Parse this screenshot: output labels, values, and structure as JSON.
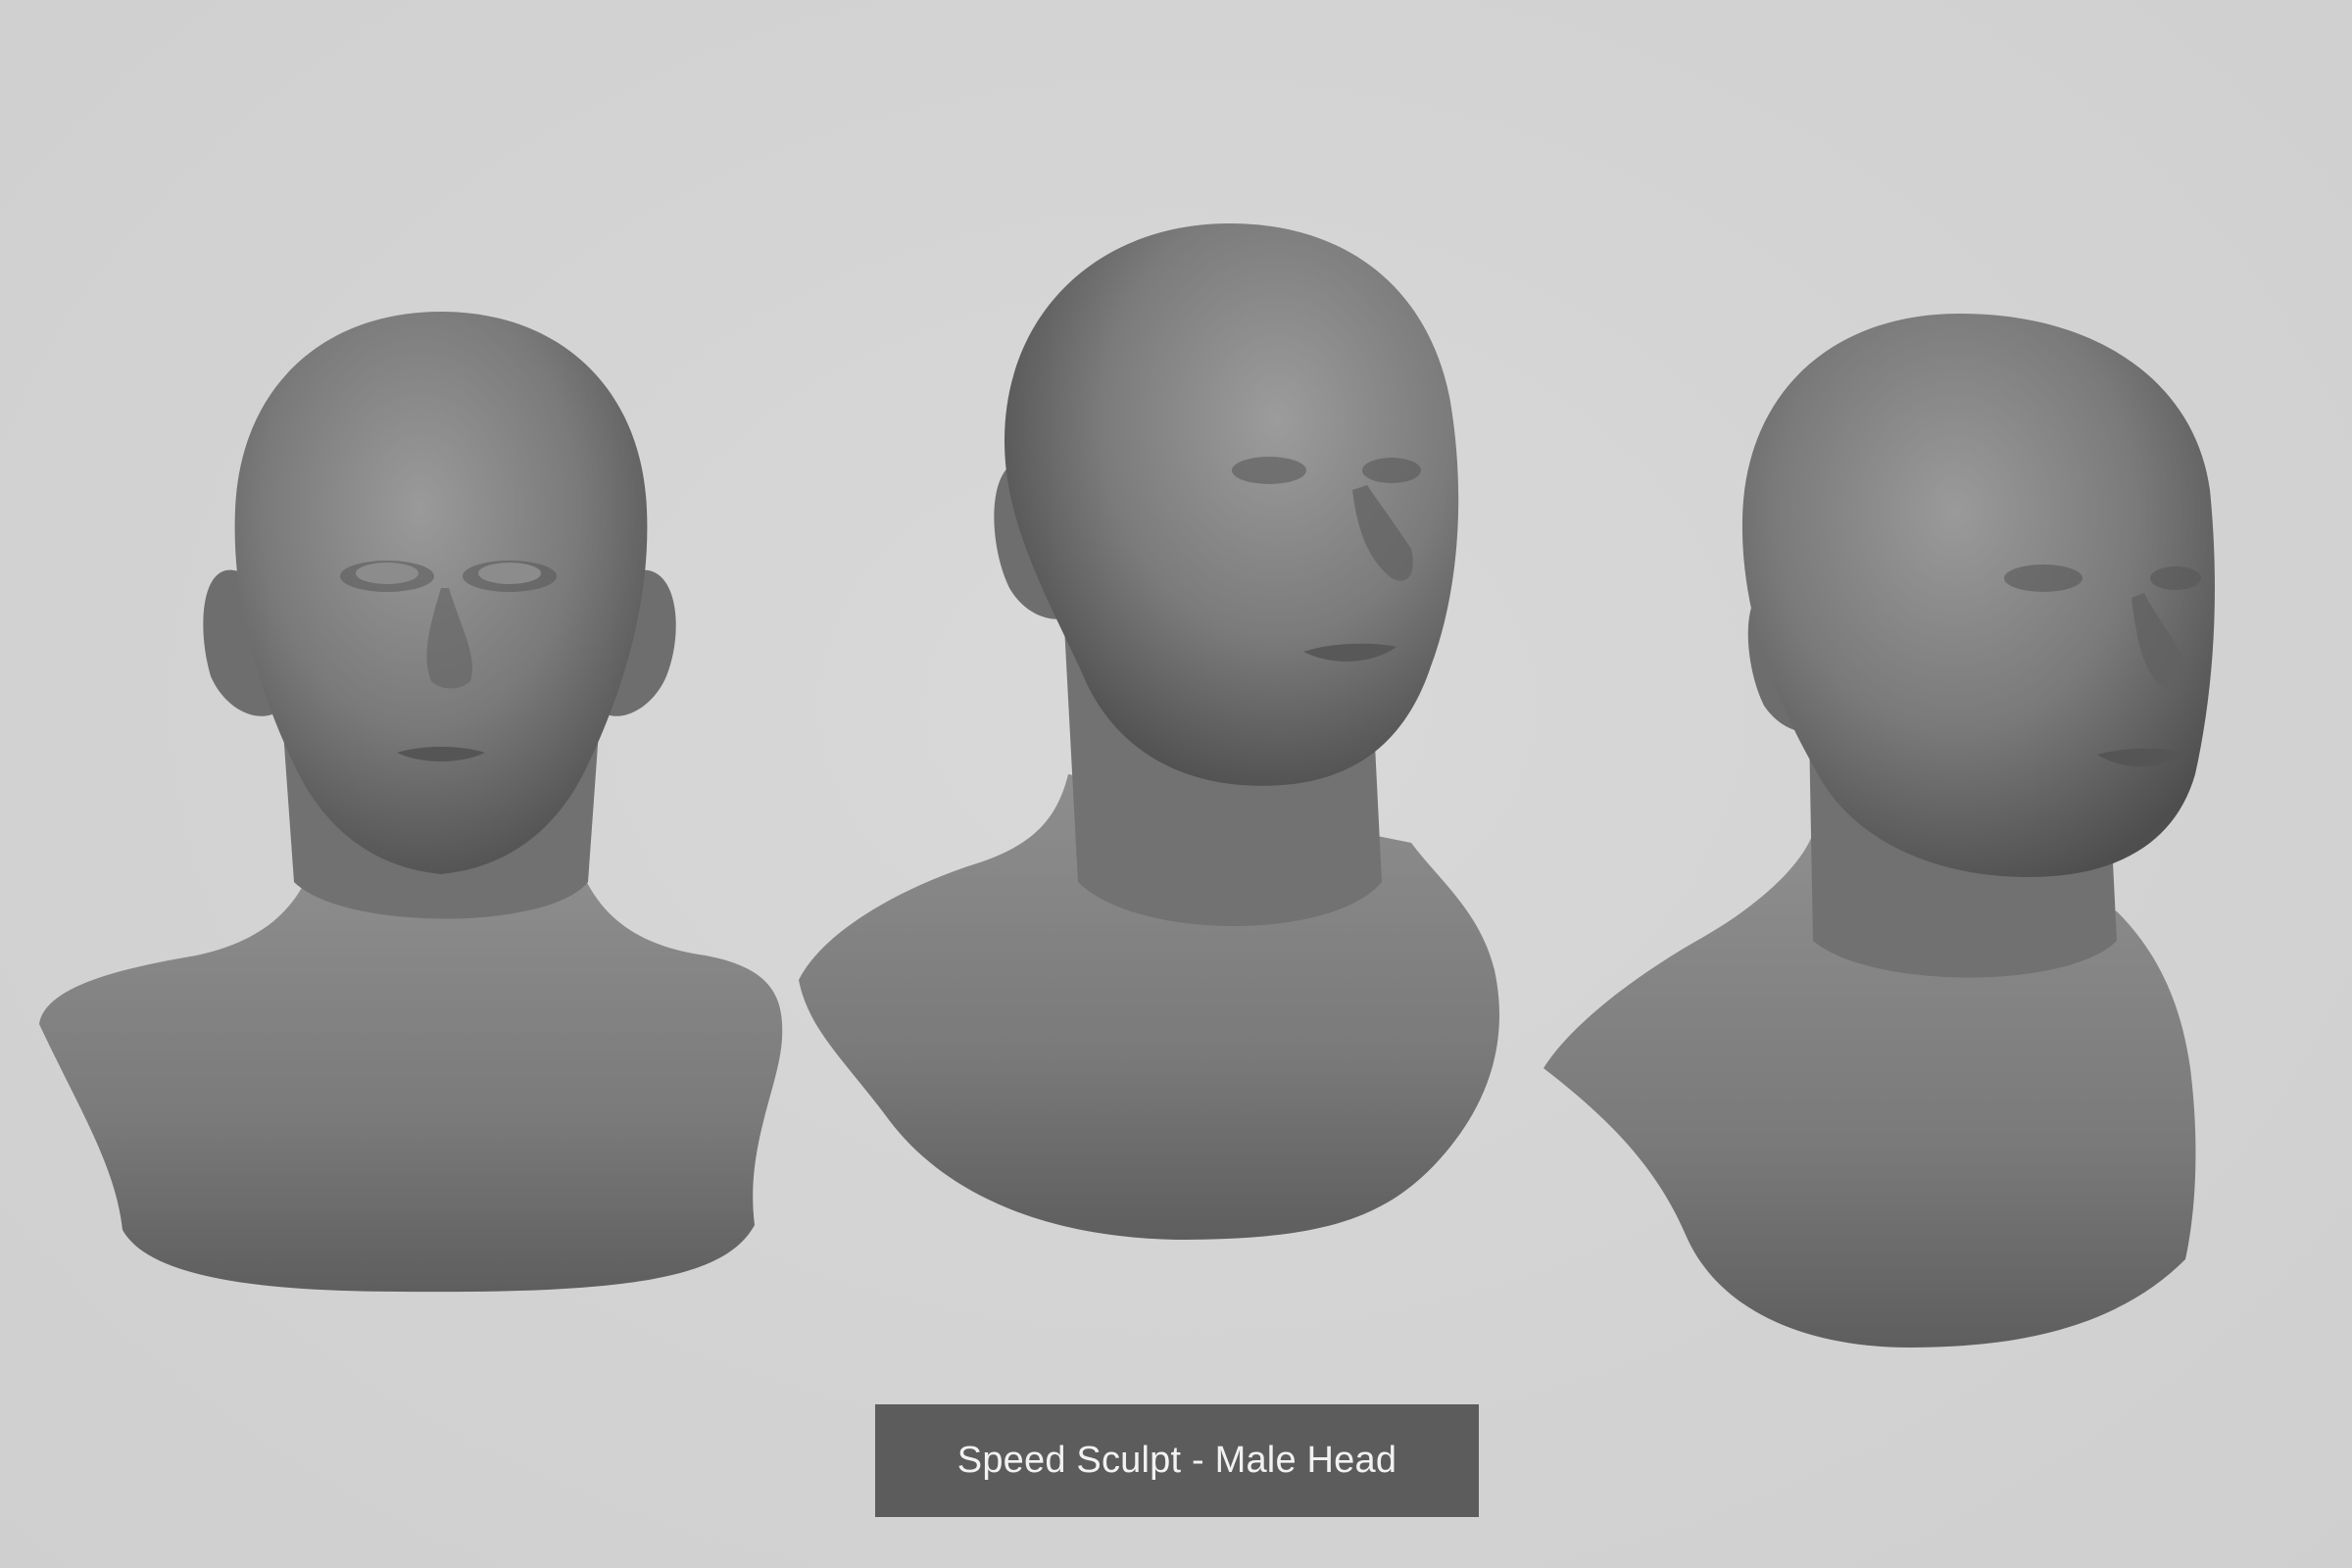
{
  "caption": {
    "text": "Speed Sculpt - Male Head"
  },
  "colors": {
    "background": "#d4d4d4",
    "caption_box": "#5c5c5c",
    "caption_text": "#f2f2f2",
    "sculpt_base": "#7a7a7a"
  },
  "sculptures": [
    {
      "view": "front"
    },
    {
      "view": "three-quarter-right"
    },
    {
      "view": "three-quarter-right-low"
    }
  ]
}
